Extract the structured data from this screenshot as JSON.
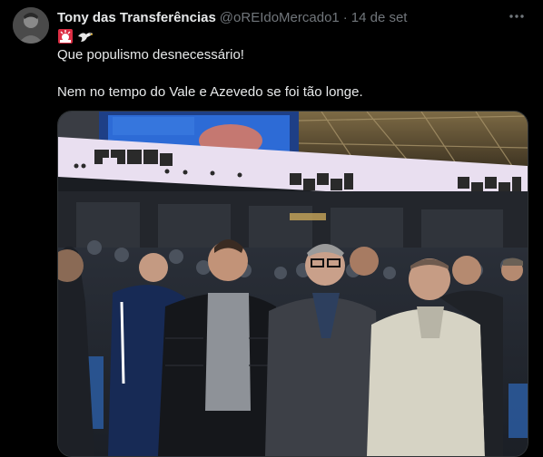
{
  "tweet": {
    "author_name": "Tony das Transferências",
    "handle": "@oREIdoMercado1",
    "separator": "·",
    "timestamp": "14 de set",
    "emojis": [
      "police-light-icon",
      "eagle-icon"
    ],
    "text_line_1": "Que populismo desnecessário!",
    "text_line_2": "Nem no tempo do Vale e Azevedo se foi tão longe.",
    "media": {
      "banner_brand": "OKX",
      "colors": {
        "banner": "#e9dff0",
        "stadium_roof": "#6b5a3a",
        "screen_blue": "#2d6bd6"
      }
    }
  }
}
